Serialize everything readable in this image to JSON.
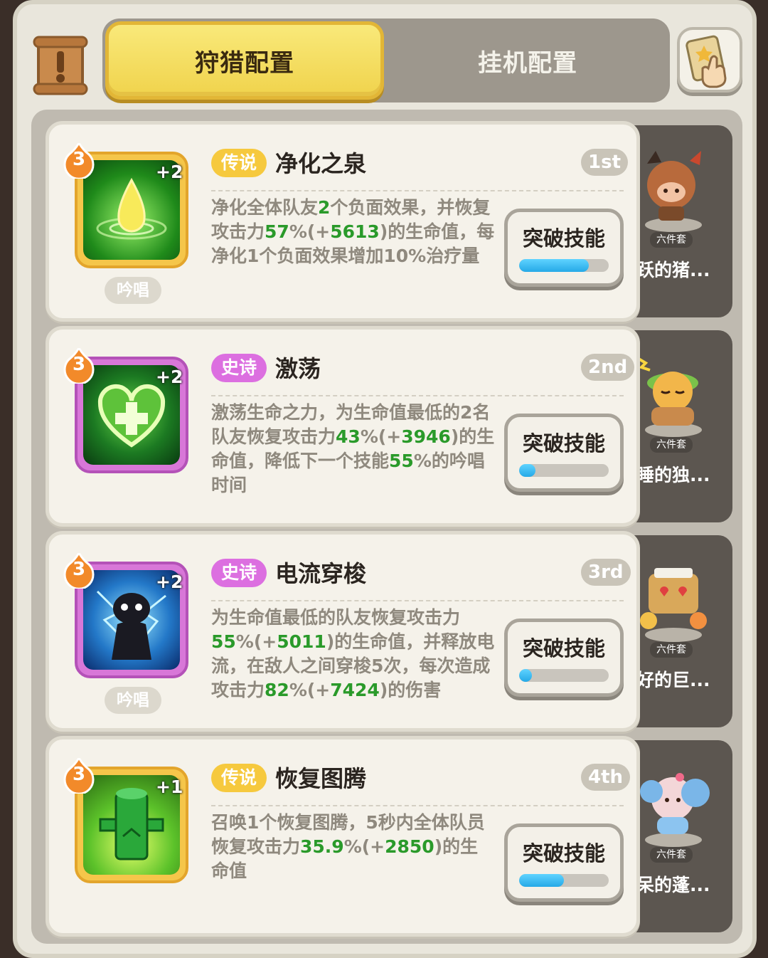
{
  "tabs": [
    {
      "label": "狩猎配置",
      "active": true
    },
    {
      "label": "挂机配置",
      "active": false
    }
  ],
  "icons": {
    "scroll": "scroll-exclamation-icon",
    "hand": "hand-tap-icon"
  },
  "skills": [
    {
      "rarity": "传说",
      "name": "净化之泉",
      "rank": "1st",
      "level": "3",
      "plus": "+2",
      "chant": "吟唱",
      "desc_parts": [
        "净化全体队友",
        "2",
        "个负面效果，并恢复攻击力",
        "57",
        "%(+",
        "5613",
        ")的生命值，每净化1个负面效果增加10%治疗量"
      ],
      "button": "突破技能",
      "progress": 0.78,
      "character_name": "活跃的猪...",
      "set_tag": "六件套"
    },
    {
      "rarity": "史诗",
      "name": "激荡",
      "rank": "2nd",
      "level": "3",
      "plus": "+2",
      "chant": "",
      "desc_parts": [
        "激荡生命之力，为生命值最低的2名队友恢复攻击力",
        "43",
        "%(+",
        "3946",
        ")的生命值，降低下一个技能",
        "55",
        "%的吟唱时间"
      ],
      "button": "突破技能",
      "progress": 0.18,
      "character_name": "酣睡的独...",
      "set_tag": "六件套"
    },
    {
      "rarity": "史诗",
      "name": "电流穿梭",
      "rank": "3rd",
      "level": "3",
      "plus": "+2",
      "chant": "吟唱",
      "desc_parts": [
        "为生命值最低的队友恢复攻击力",
        "55",
        "%(+",
        "5011",
        ")的生命值，并释放电流，在敌人之间穿梭5次，每次造成攻击力",
        "82",
        "%(+",
        "7424",
        ")的伤害"
      ],
      "button": "突破技能",
      "progress": 0.14,
      "character_name": "友好的巨...",
      "set_tag": "六件套"
    },
    {
      "rarity": "传说",
      "name": "恢复图腾",
      "rank": "4th",
      "level": "3",
      "plus": "+1",
      "chant": "",
      "desc_parts": [
        "召唤1个恢复图腾，5秒内全体队员恢复攻击力",
        "35.9",
        "%(+",
        "2850",
        ")的生命值"
      ],
      "button": "突破技能",
      "progress": 0.5,
      "character_name": "发呆的蓬...",
      "set_tag": "六件套"
    }
  ]
}
